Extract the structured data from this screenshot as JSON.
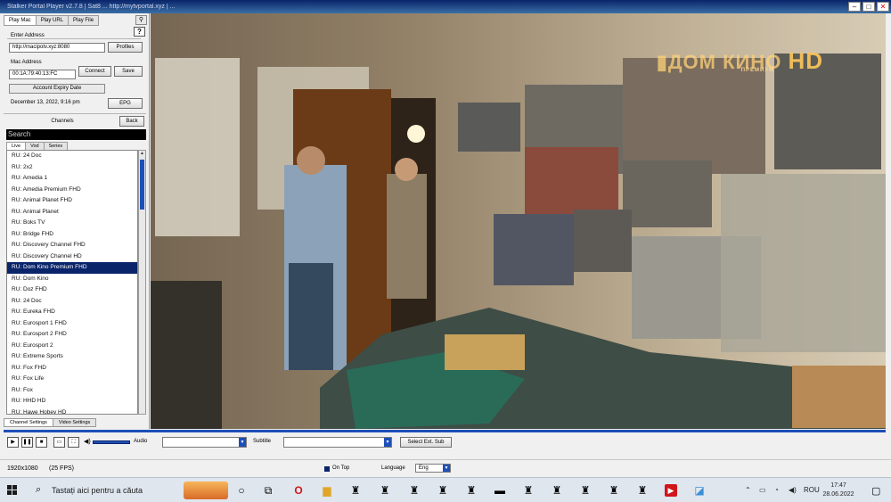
{
  "window": {
    "title": "Stalker Portal Player v2.7.8 | Sat8 ... http://mytvportal.xyz | ..."
  },
  "left_panel": {
    "tabs": [
      "Play Mac",
      "Play URL",
      "Play File"
    ],
    "portal_label": "Enter Address",
    "portal_value": "http://macipotv.xyz:8080",
    "profiles_button": "Profiles",
    "mac_label": "Mac Address",
    "mac_value": "00:1A:79:40:13:FC",
    "connect_button": "Connect",
    "save_button": "Save",
    "expiry_header": "Account Expiry Date",
    "expiry_value": "December 13, 2022, 9:16 pm",
    "epg_button": "EPG",
    "channels_label": "Channels",
    "back_button": "Back",
    "search_placeholder": "Search",
    "list_tabs": [
      "Live",
      "Vod",
      "Series"
    ],
    "channels": [
      "RU: 24 Doc",
      "RU: 2x2",
      "RU: Amedia 1",
      "RU: Amedia Premium FHD",
      "RU: Animal Planet FHD",
      "RU: Animal Planet",
      "RU: Boks TV",
      "RU: Bridge FHD",
      "RU: Discovery Channel FHD",
      "RU: Discovery Channel HD",
      "RU: Dom Kino Premium FHD",
      "RU: Dom Kino",
      "RU: Doz FHD",
      "RU: 24 Doc",
      "RU: Eureka FHD",
      "RU: Eurosport 1 FHD",
      "RU: Eurosport 2 FHD",
      "RU: Eurosport 2",
      "RU: Extreme Sports",
      "RU: Fox FHD",
      "RU: Fox Life",
      "RU: Fox",
      "RU: HHD HD",
      "RU: Hawe Hobey HD"
    ],
    "selected_channel": "RU: Dom Kino Premium FHD",
    "bottom_tabs": [
      "Channel Settings",
      "Video Settings"
    ]
  },
  "video": {
    "watermark_main": "ДОМ КИНО",
    "watermark_hd": "HD",
    "watermark_sub": "ПРЕМИУМ"
  },
  "controls": {
    "audio_label": "Audio",
    "subtitle_label": "Subtitle",
    "select_sub_button": "Select Ext. Sub"
  },
  "status": {
    "resolution": "1920x1080",
    "fps": "(25 FPS)",
    "on_top": "On Top",
    "language_label": "Language",
    "language_value": "Eng"
  },
  "taskbar": {
    "search_placeholder": "Tastați aici pentru a căuta",
    "lang": "ROU",
    "time": "17:47",
    "date": "28.06.2022"
  },
  "colors": {
    "title_bar": "#0a246a",
    "selection": "#0a246a",
    "accent": "#1e4fb8"
  }
}
